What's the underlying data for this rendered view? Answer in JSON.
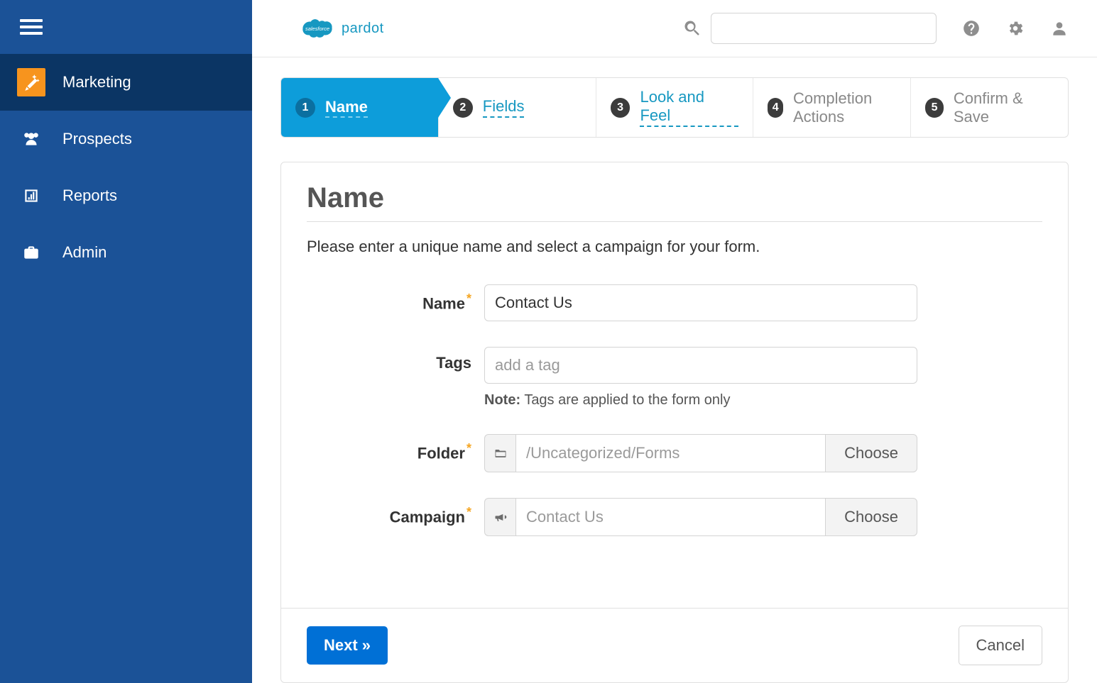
{
  "brand": {
    "product": "pardot"
  },
  "sidebar": {
    "items": [
      {
        "label": "Marketing",
        "active": true
      },
      {
        "label": "Prospects",
        "active": false
      },
      {
        "label": "Reports",
        "active": false
      },
      {
        "label": "Admin",
        "active": false
      }
    ]
  },
  "wizard": {
    "steps": [
      {
        "num": "1",
        "label": "Name",
        "state": "active"
      },
      {
        "num": "2",
        "label": "Fields",
        "state": "link"
      },
      {
        "num": "3",
        "label": "Look and Feel",
        "state": "link"
      },
      {
        "num": "4",
        "label": "Completion Actions",
        "state": "future"
      },
      {
        "num": "5",
        "label": "Confirm & Save",
        "state": "future"
      }
    ]
  },
  "panel": {
    "title": "Name",
    "description": "Please enter a unique name and select a campaign for your form.",
    "fields": {
      "name": {
        "label": "Name",
        "required": true,
        "value": "Contact Us"
      },
      "tags": {
        "label": "Tags",
        "required": false,
        "placeholder": "add a tag",
        "note_label": "Note:",
        "note_text": "Tags are applied to the form only"
      },
      "folder": {
        "label": "Folder",
        "required": true,
        "value": "/Uncategorized/Forms",
        "button": "Choose"
      },
      "campaign": {
        "label": "Campaign",
        "required": true,
        "value": "Contact Us",
        "button": "Choose"
      }
    }
  },
  "footer": {
    "next": "Next »",
    "cancel": "Cancel"
  }
}
